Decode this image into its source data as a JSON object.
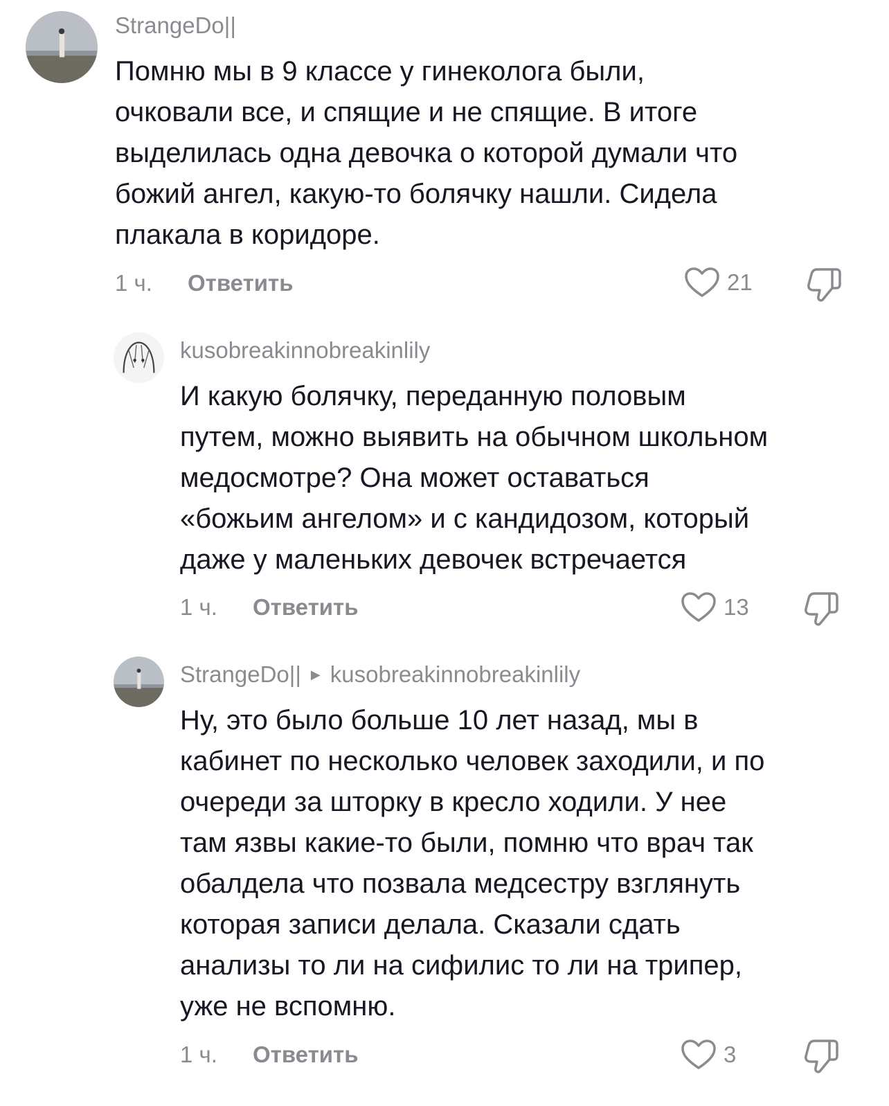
{
  "comments": [
    {
      "username": "StrangeDo||",
      "text": "Помню мы в 9 классе у гинеколога были,\nочковали все, и спящие и не спящие. В итоге\nвыделилась одна девочка о которой думали что\nбожий ангел, какую-то болячку нашли. Сидела\nплакала в коридоре.",
      "time": "1 ч.",
      "reply_label": "Ответить",
      "likes": "21",
      "avatar_icon": "beach-photo-avatar"
    },
    {
      "username": "kusobreakinnobreakinlily",
      "text": "И какую болячку, переданную половым\nпутем, можно выявить на обычном школьном\nмедосмотре? Она может оставаться\n«божьим ангелом» и с кандидозом, который\nдаже у маленьких девочек встречается",
      "time": "1 ч.",
      "reply_label": "Ответить",
      "likes": "13",
      "avatar_icon": "manga-drawing-avatar"
    },
    {
      "username": "StrangeDo||",
      "reply_to": "kusobreakinnobreakinlily",
      "text": "Ну, это было больше 10 лет назад, мы в\nкабинет по несколько человек заходили, и по\nочереди за шторку в кресло ходили. У нее\nтам язвы какие-то были, помню что врач так\nобалдела что позвала медсестру взглянуть\nкоторая записи делала. Сказали сдать\nанализы то ли на сифилис то ли на трипер,\nуже не вспомню.",
      "time": "1 ч.",
      "reply_label": "Ответить",
      "likes": "3",
      "avatar_icon": "beach-photo-avatar"
    }
  ],
  "icons": {
    "like": "heart-outline-icon",
    "dislike": "thumbs-down-outline-icon",
    "reply_to": "triangle-right-icon"
  },
  "colors": {
    "text": "#161823",
    "secondary": "#8a8b91"
  }
}
